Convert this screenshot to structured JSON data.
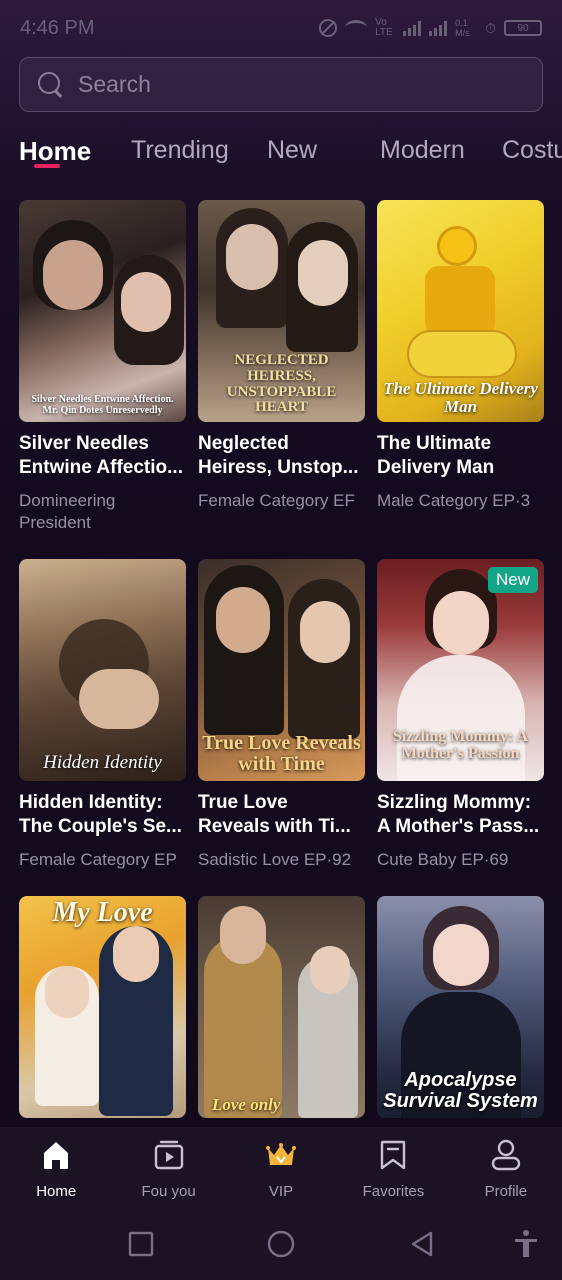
{
  "status_bar": {
    "time": "4:46 PM",
    "network": "Vo LTE",
    "speed": "0.1 M/s",
    "battery": "90"
  },
  "search": {
    "placeholder": "Search",
    "value": ""
  },
  "tabs": [
    {
      "label": "Home",
      "active": true
    },
    {
      "label": "Trending",
      "active": false
    },
    {
      "label": "New",
      "active": false
    },
    {
      "label": "Modern",
      "active": false
    },
    {
      "label": "Costu",
      "active": false
    }
  ],
  "cards": [
    {
      "title_line1": "Silver Needles",
      "title_line2": "Entwine Affectio...",
      "subtitle": "Domineering President",
      "poster_text": "Silver Needles Entwine Affection. Mr. Qin Dotes Unreservedly",
      "badge": ""
    },
    {
      "title_line1": "Neglected",
      "title_line2": "Heiress, Unstop...",
      "subtitle": "Female Category EF",
      "poster_text": "NEGLECTED HEIRESS, UNSTOPPABLE HEART",
      "badge": ""
    },
    {
      "title_line1": "The Ultimate",
      "title_line2": "Delivery Man",
      "subtitle": "Male Category EP·3",
      "poster_text": "The Ultimate Delivery Man",
      "badge": ""
    },
    {
      "title_line1": "Hidden Identity:",
      "title_line2": "The Couple's Se...",
      "subtitle": "Female Category EP",
      "poster_text": "Hidden Identity",
      "badge": ""
    },
    {
      "title_line1": "True Love",
      "title_line2": "Reveals with Ti...",
      "subtitle": "Sadistic Love EP·92",
      "poster_text": "True Love Reveals with Time",
      "badge": ""
    },
    {
      "title_line1": "Sizzling Mommy:",
      "title_line2": "A Mother's Pass...",
      "subtitle": "Cute Baby EP·69",
      "poster_text": "Sizzling Mommy: A Mother's Passion",
      "badge": "New"
    },
    {
      "title_line1": "",
      "title_line2": "",
      "subtitle": "",
      "poster_text": "My Love",
      "badge": ""
    },
    {
      "title_line1": "",
      "title_line2": "",
      "subtitle": "",
      "poster_text": "Love only",
      "badge": ""
    },
    {
      "title_line1": "",
      "title_line2": "",
      "subtitle": "",
      "poster_text": "Apocalypse Survival System",
      "badge": ""
    }
  ],
  "bottom_nav": [
    {
      "label": "Home",
      "icon": "home-icon",
      "active": true
    },
    {
      "label": "Fou you",
      "icon": "play-video-icon",
      "active": false
    },
    {
      "label": "VIP",
      "icon": "crown-icon",
      "active": false
    },
    {
      "label": "Favorites",
      "icon": "bookmark-icon",
      "active": false
    },
    {
      "label": "Profile",
      "icon": "profile-icon",
      "active": false
    }
  ],
  "colors": {
    "accent": "#e8215f",
    "badge_new": "#13a587",
    "vip_gold": "#f2b53a",
    "background": "#140b1f"
  }
}
